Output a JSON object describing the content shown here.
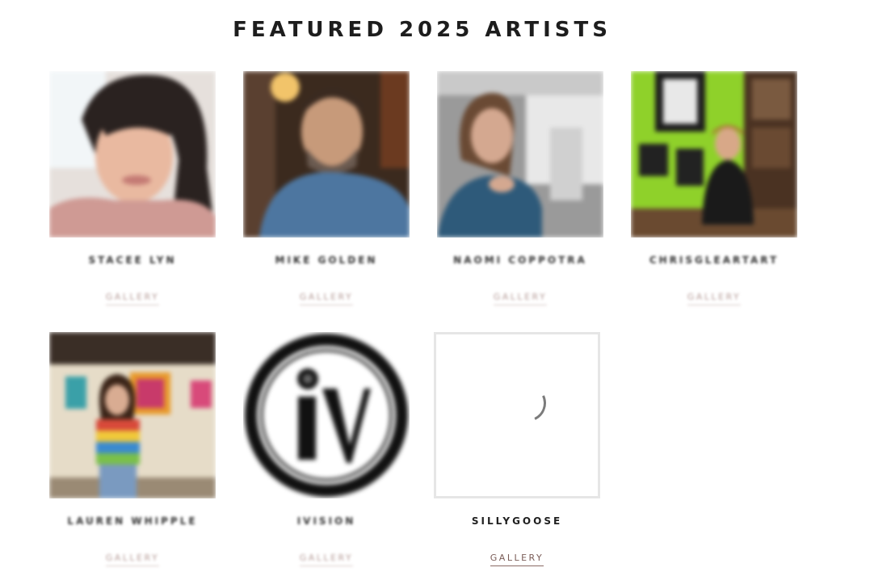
{
  "section": {
    "title": "FEATURED 2025 ARTISTS"
  },
  "artists": [
    {
      "name": "STACEE LYN",
      "link": "GALLERY",
      "image": "portrait-woman-pink-hoodie",
      "accent": "#d9a9a6"
    },
    {
      "name": "MIKE GOLDEN",
      "link": "GALLERY",
      "image": "portrait-bearded-man",
      "accent": "#5077a0"
    },
    {
      "name": "NAOMI COPPOTRA",
      "link": "GALLERY",
      "image": "portrait-woman-gray-room",
      "accent": "#2e5a7a"
    },
    {
      "name": "CHRISGLEARTART",
      "link": "GALLERY",
      "image": "portrait-man-green-wall",
      "accent": "#8fd12a"
    },
    {
      "name": "LAUREN WHIPPLE",
      "link": "GALLERY",
      "image": "portrait-woman-gallery",
      "accent": "#c24a3a"
    },
    {
      "name": "IVISION",
      "link": "GALLERY",
      "image": "iv-logo",
      "accent": "#111111"
    },
    {
      "name": "SILLYGOOSE",
      "link": "GALLERY",
      "image": "loading-spinner",
      "accent": "#7a5c57"
    }
  ],
  "colors": {
    "link": "#7a5c57",
    "heading": "#1d1d1d"
  }
}
